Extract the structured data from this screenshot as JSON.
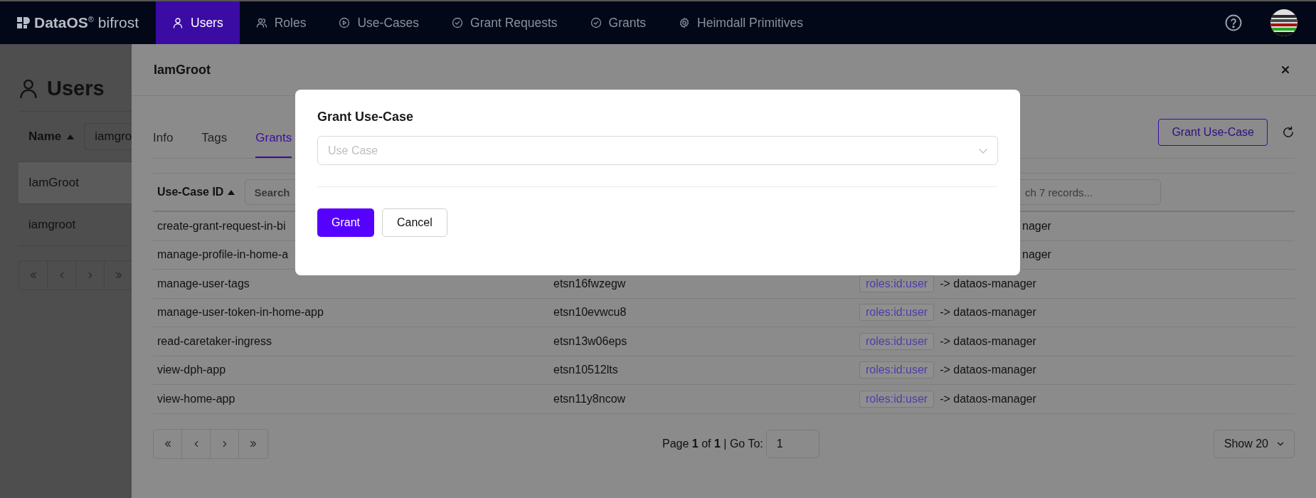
{
  "nav": {
    "logo": "**DataOS**$^{®}$ bifrost",
    "items": [
      {
        "label": "Users",
        "selected": true
      },
      {
        "label": "Roles",
        "selected": false
      },
      {
        "label": "Use-Cases",
        "selected": false
      },
      {
        "label": "Grant Requests",
        "selected": false
      },
      {
        "label": "Grants",
        "selected": false
      },
      {
        "label": "Heimdall Primitives",
        "selected": false
      }
    ]
  },
  "users_page": {
    "title": "Users",
    "filter": {
      "column": "Name",
      "value": "iamgro"
    },
    "rows": [
      {
        "name": "IamGroot",
        "selected": true
      },
      {
        "name": "iamgroot",
        "selected": false
      }
    ]
  },
  "drawer": {
    "title": "IamGroot",
    "tabs": [
      {
        "label": "Info",
        "selected": false
      },
      {
        "label": "Tags",
        "selected": false
      },
      {
        "label": "Grants",
        "selected": true
      }
    ],
    "action": "Grant Use-Case",
    "table": {
      "column_1": {
        "label": "Use-Case ID",
        "placeholder": "Search"
      },
      "column_3": {
        "placeholder": "ch 7 records..."
      },
      "rows": [
        {
          "use_case": "create-grant-request-in-bi",
          "target": "nager"
        },
        {
          "use_case": "manage-profile-in-home-a",
          "target": "nager"
        },
        {
          "use_case": "manage-user-tags",
          "id": "etsn16fwzegw",
          "role": "roles:id:user",
          "target": "-> dataos-manager"
        },
        {
          "use_case": "manage-user-token-in-home-app",
          "id": "etsn10evwcu8",
          "role": "roles:id:user",
          "target": "-> dataos-manager"
        },
        {
          "use_case": "read-caretaker-ingress",
          "id": "etsn13w06eps",
          "role": "roles:id:user",
          "target": "-> dataos-manager"
        },
        {
          "use_case": "view-dph-app",
          "id": "etsn10512lts",
          "role": "roles:id:user",
          "target": "-> dataos-manager"
        },
        {
          "use_case": "view-home-app",
          "id": "etsn11y8ncow",
          "role": "roles:id:user",
          "target": "-> dataos-manager"
        }
      ]
    },
    "pagination": {
      "page_text": "Page **1** of **1** | Go To:",
      "go_to": "1",
      "page_size": "Show 20"
    }
  },
  "modal": {
    "title": "Grant Use-Case",
    "select": {
      "placeholder": "Use Case"
    },
    "buttons": [
      {
        "label": "Grant",
        "kind": "primary"
      },
      {
        "label": "Cancel",
        "kind": "secondary"
      }
    ]
  }
}
